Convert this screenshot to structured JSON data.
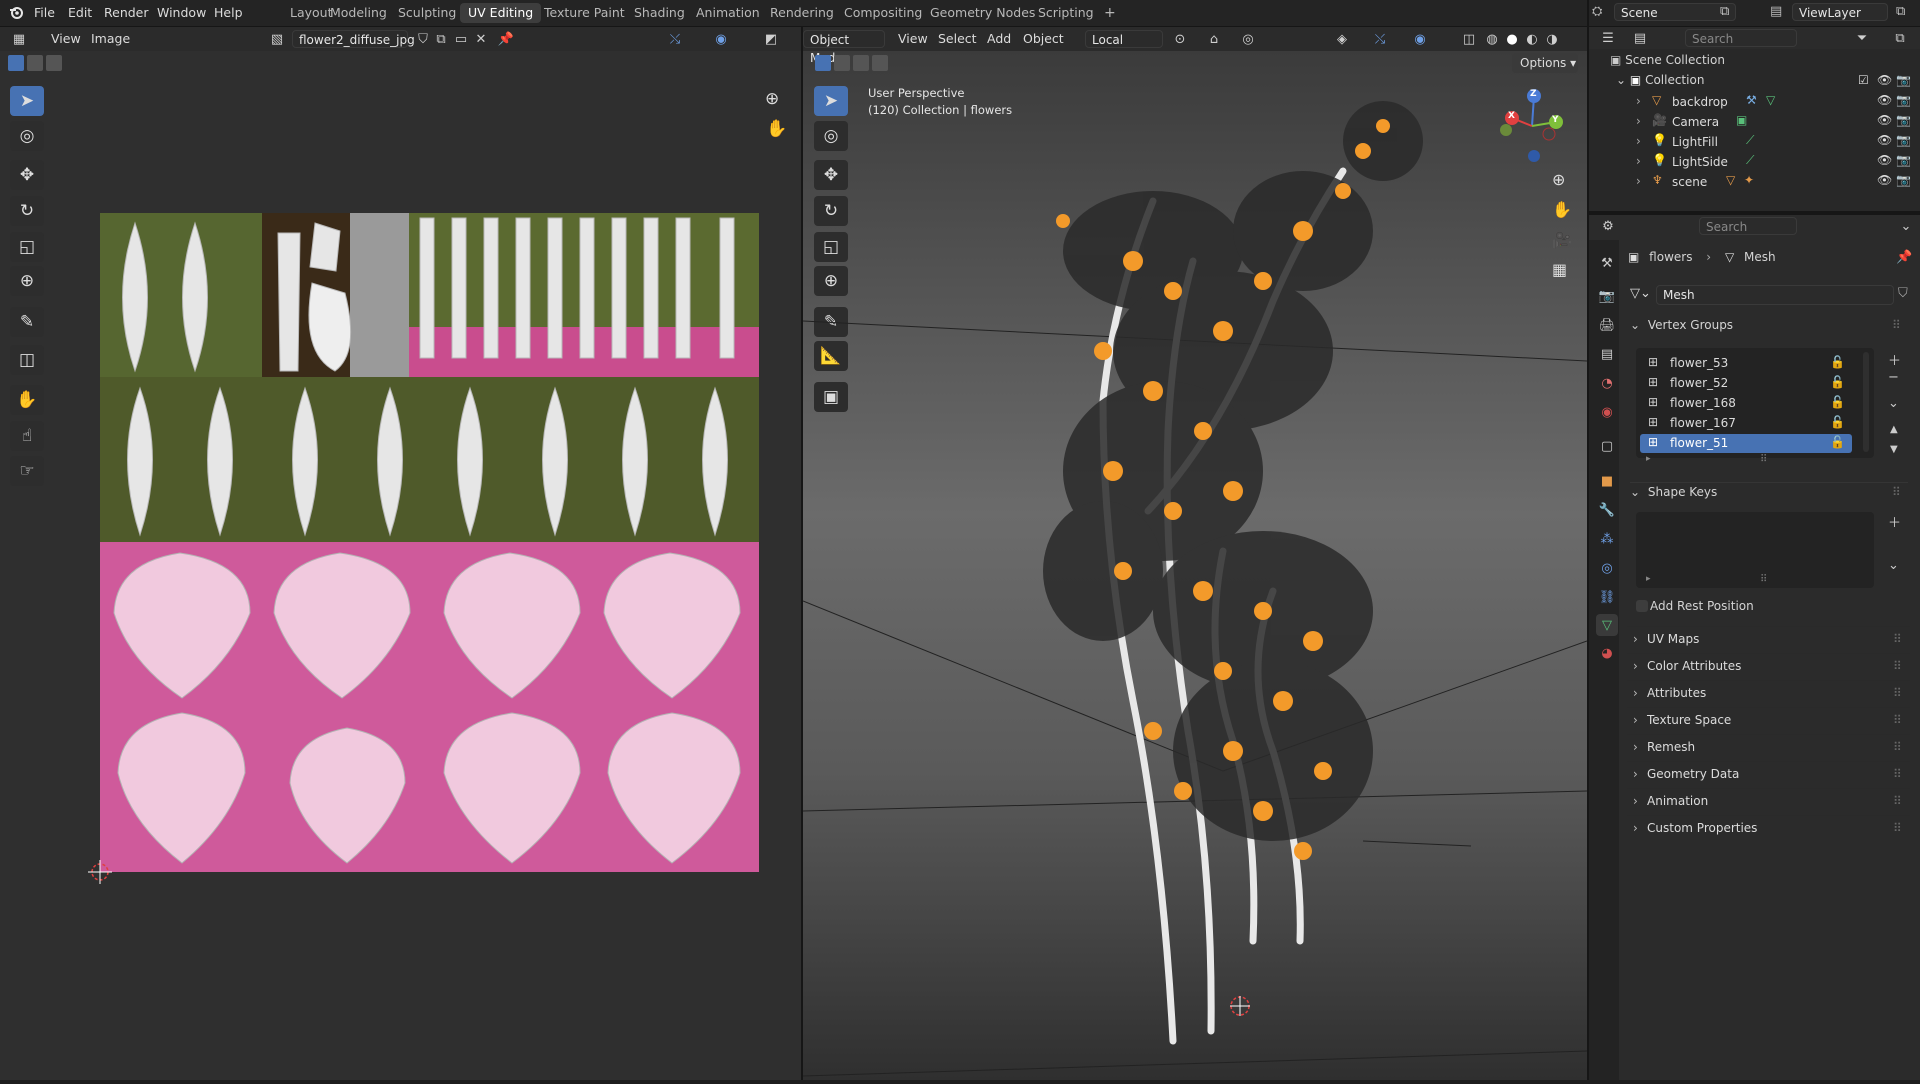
{
  "menu": {
    "file": "File",
    "edit": "Edit",
    "render": "Render",
    "window": "Window",
    "help": "Help"
  },
  "workspaces": [
    "Layout",
    "Modeling",
    "Sculpting",
    "UV Editing",
    "Texture Paint",
    "Shading",
    "Animation",
    "Rendering",
    "Compositing",
    "Geometry Nodes",
    "Scripting"
  ],
  "active_workspace": "UV Editing",
  "add_workspace": "+",
  "scene": {
    "name": "Scene",
    "viewlayer": "ViewLayer"
  },
  "uv_editor": {
    "view": "View",
    "image": "Image",
    "image_name": "flower2_diffuse_jpg"
  },
  "viewport": {
    "mode": "Object Mode",
    "view": "View",
    "select": "Select",
    "add": "Add",
    "object": "Object",
    "orientation": "Local",
    "options": "Options",
    "overlay_line1": "User Perspective",
    "overlay_line2": "(120) Collection | flowers",
    "gizmo": {
      "z": "Z",
      "x": "X",
      "y": "Y"
    }
  },
  "outliner": {
    "search_placeholder": "Search",
    "root": "Scene Collection",
    "collection": "Collection",
    "items": [
      {
        "name": "backdrop",
        "icon": "triangle-mesh-icon",
        "color": "#e2994a"
      },
      {
        "name": "Camera",
        "icon": "camera-icon",
        "color": "#e2994a"
      },
      {
        "name": "LightFill",
        "icon": "light-icon",
        "color": "#e2994a"
      },
      {
        "name": "LightSide",
        "icon": "light-icon",
        "color": "#e2994a"
      },
      {
        "name": "scene",
        "icon": "armature-icon",
        "color": "#e2994a"
      }
    ]
  },
  "properties": {
    "search_placeholder": "Search",
    "breadcrumb_object": "flowers",
    "breadcrumb_data": "Mesh",
    "mesh_name": "Mesh",
    "vertex_groups_title": "Vertex Groups",
    "vertex_groups": [
      "flower_53",
      "flower_52",
      "flower_168",
      "flower_167",
      "flower_51"
    ],
    "selected_vertex_group": "flower_51",
    "shape_keys_title": "Shape Keys",
    "add_rest_position": "Add Rest Position",
    "panels": [
      "UV Maps",
      "Color Attributes",
      "Attributes",
      "Texture Space",
      "Remesh",
      "Geometry Data",
      "Animation",
      "Custom Properties"
    ]
  },
  "colors": {
    "accent": "#4772b3",
    "texture_pink": "#cf5a9b",
    "texture_green": "#4f5a2a",
    "flower_orange": "#f39a2a"
  }
}
